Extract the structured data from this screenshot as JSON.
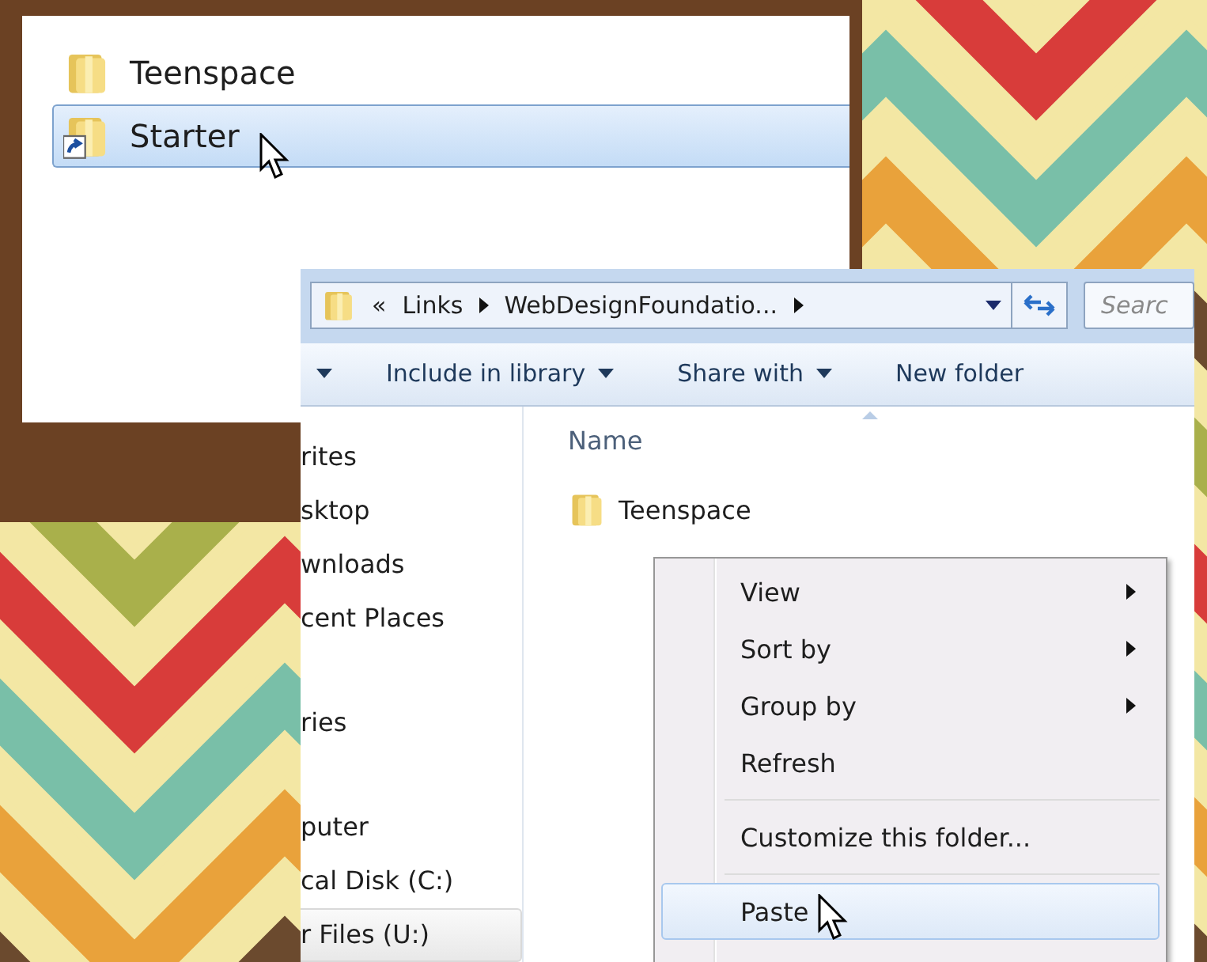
{
  "inset_window": {
    "items": [
      {
        "name": "Teenspace",
        "shortcut": false,
        "selected": false
      },
      {
        "name": "Starter",
        "shortcut": true,
        "selected": true
      }
    ]
  },
  "explorer_window": {
    "address": {
      "overflow": "«",
      "breadcrumbs": [
        "Links",
        "WebDesignFoundatio..."
      ]
    },
    "search": {
      "placeholder": "Searc"
    },
    "toolbar": [
      {
        "label": "Include in library",
        "menu": true
      },
      {
        "label": "Share with",
        "menu": true
      },
      {
        "label": "New folder",
        "menu": false
      }
    ],
    "nav_pane": [
      {
        "items": [
          {
            "label": "rites",
            "selected": false
          },
          {
            "label": "sktop",
            "selected": false
          },
          {
            "label": "wnloads",
            "selected": false
          },
          {
            "label": "cent Places",
            "selected": false
          }
        ]
      },
      {
        "items": [
          {
            "label": "ries",
            "selected": false
          }
        ]
      },
      {
        "items": [
          {
            "label": "puter",
            "selected": false
          },
          {
            "label": "cal Disk (C:)",
            "selected": false
          },
          {
            "label": "r Files (U:)",
            "selected": true
          }
        ]
      }
    ],
    "columns": [
      "Name"
    ],
    "files": [
      {
        "name": "Teenspace"
      }
    ],
    "context_menu": [
      {
        "kind": "item",
        "label": "View",
        "submenu": true,
        "selected": false
      },
      {
        "kind": "item",
        "label": "Sort by",
        "submenu": true,
        "selected": false
      },
      {
        "kind": "item",
        "label": "Group by",
        "submenu": true,
        "selected": false
      },
      {
        "kind": "item",
        "label": "Refresh",
        "submenu": false,
        "selected": false
      },
      {
        "kind": "separator"
      },
      {
        "kind": "item",
        "label": "Customize this folder...",
        "submenu": false,
        "selected": false
      },
      {
        "kind": "separator"
      },
      {
        "kind": "item",
        "label": "Paste",
        "submenu": false,
        "selected": true
      }
    ]
  }
}
